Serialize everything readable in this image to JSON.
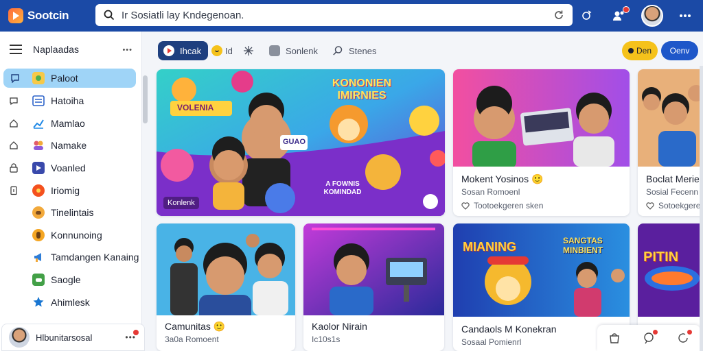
{
  "app": {
    "name": "Sootcin"
  },
  "search": {
    "query": "Ir Sosiatli lay Kndegenoan."
  },
  "sidebar": {
    "title": "Naplaadas",
    "items": [
      {
        "label": "Paloot",
        "active": true,
        "icon": "chat-icon",
        "color": "#3f6fe0"
      },
      {
        "label": "Hatoiha",
        "icon": "list-icon",
        "color": "#2b62c9"
      },
      {
        "label": "Mamlao",
        "icon": "chart-icon",
        "color": "#1e88e5"
      },
      {
        "label": "Namake",
        "icon": "people-icon",
        "color": "#e35d6a"
      },
      {
        "label": "Voanled",
        "icon": "video-icon",
        "color": "#3949ab"
      },
      {
        "label": "Iriomig",
        "icon": "fire-icon",
        "color": "#f4511e"
      },
      {
        "label": "Tinelintais",
        "icon": "pet-icon",
        "color": "#f2a93b"
      },
      {
        "label": "Konnunoing",
        "icon": "globe-icon",
        "color": "#f5a623"
      },
      {
        "label": "Tamdangen Kanaing",
        "icon": "megaphone-icon",
        "color": "#2e7dd7"
      },
      {
        "label": "Saogle",
        "icon": "gamepad-icon",
        "color": "#43a047"
      },
      {
        "label": "Ahimlesk",
        "icon": "star-icon",
        "color": "#1976d2"
      }
    ],
    "profile": {
      "name": "Hlbunitarsosal"
    }
  },
  "filters": {
    "chips": [
      {
        "label": "Ihcak",
        "active": true,
        "icon": "play-icon"
      },
      {
        "label": "Id",
        "icon": "emoji-icon"
      },
      {
        "label": "",
        "icon": "sparkle-icon"
      },
      {
        "label": "Sonlenk",
        "icon": "grid-icon"
      },
      {
        "label": "Stenes",
        "icon": "search-icon"
      }
    ],
    "yellow_button": "Den",
    "blue_button": "Oenv"
  },
  "hero": {
    "headline": "KONONIEN IMIRNIES",
    "sticker_left": "VOLENIA",
    "sticker_bubble": "GUAO",
    "caption": "A FOWNIS KOMINDAD",
    "badge": "Konlenk"
  },
  "cards": {
    "card1": {
      "title": "Mokent Yosinos",
      "emoji": "🙂",
      "subtitle": "Sosan Romoenl",
      "meta": "Tootoekgeren sken"
    },
    "card2": {
      "title": "Boclat Meriec",
      "subtitle": "Sosial Fecenn",
      "meta": "Sotoekgerei"
    },
    "card3": {
      "title": "Camunitas",
      "emoji": "🙂",
      "subtitle": "3a0a Romoent"
    },
    "card4": {
      "title": "Kaolor Nirain",
      "subtitle": "Ic10s1s"
    },
    "card5": {
      "title": "Candaols M Konekran",
      "subtitle": "Sosaal Pomienrl",
      "banner": "MIANING",
      "banner2": "SANGTAS MINBIENT"
    },
    "card6": {
      "banner": "PITIN"
    }
  }
}
